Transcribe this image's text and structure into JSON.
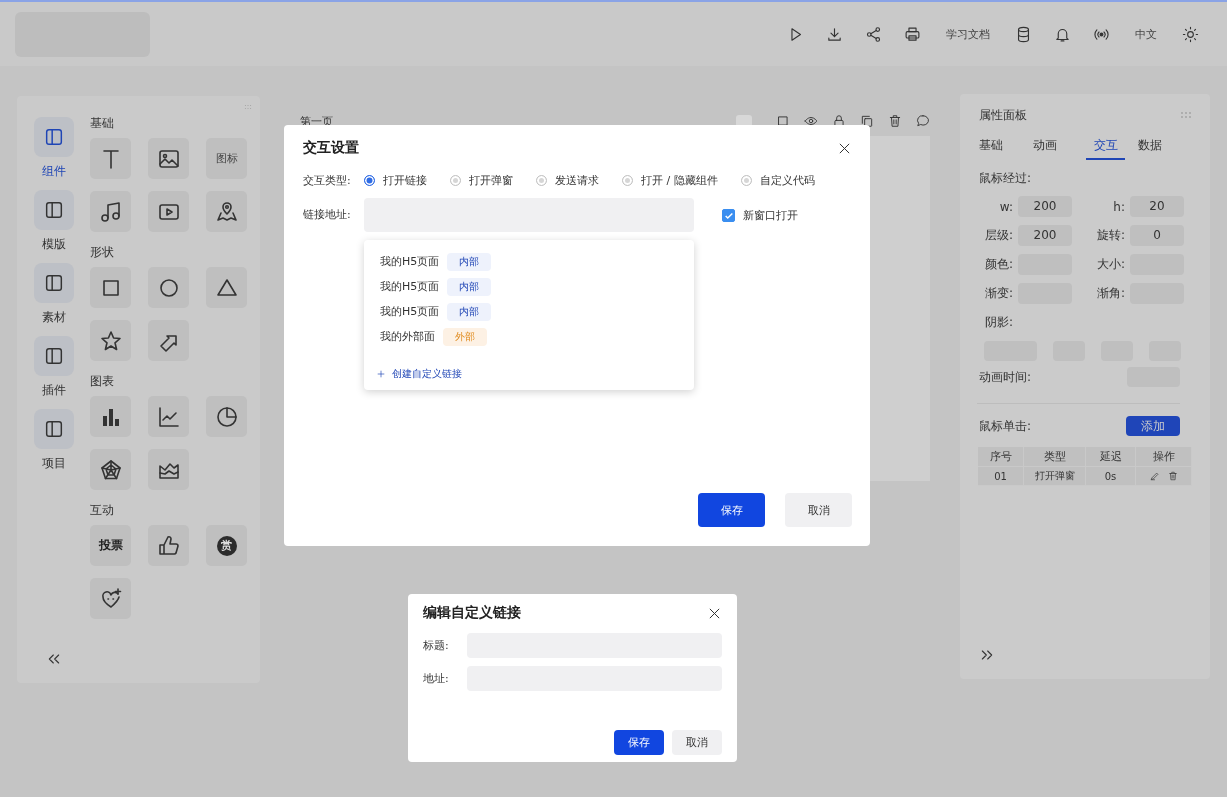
{
  "topbar": {
    "doc_link": "学习文档",
    "language": "中文"
  },
  "left_nav": [
    {
      "label": "组件",
      "selected": true
    },
    {
      "label": "模版",
      "selected": false
    },
    {
      "label": "素材",
      "selected": false
    },
    {
      "label": "插件",
      "selected": false
    },
    {
      "label": "项目",
      "selected": false
    }
  ],
  "component_groups": [
    {
      "title": "基础",
      "items": [
        {
          "kind": "icon"
        },
        {
          "kind": "icon"
        },
        {
          "kind": "label",
          "label": "图标"
        },
        {
          "kind": "icon"
        },
        {
          "kind": "icon"
        },
        {
          "kind": "icon"
        }
      ]
    },
    {
      "title": "形状",
      "items": [
        {
          "kind": "icon"
        },
        {
          "kind": "icon"
        },
        {
          "kind": "icon"
        },
        {
          "kind": "icon"
        },
        {
          "kind": "icon"
        }
      ]
    },
    {
      "title": "图表",
      "items": [
        {
          "kind": "icon"
        },
        {
          "kind": "icon"
        },
        {
          "kind": "icon"
        },
        {
          "kind": "icon"
        },
        {
          "kind": "icon"
        }
      ]
    },
    {
      "title": "互动",
      "items": [
        {
          "kind": "bold",
          "label": "投票"
        },
        {
          "kind": "icon"
        },
        {
          "kind": "coin",
          "label": "赏"
        },
        {
          "kind": "icon"
        }
      ]
    }
  ],
  "canvas": {
    "page_title": "第一页"
  },
  "property_panel": {
    "title": "属性面板",
    "tabs": [
      {
        "label": "基础",
        "selected": false
      },
      {
        "label": "动画",
        "selected": false
      },
      {
        "label": "交互",
        "selected": true
      },
      {
        "label": "数据",
        "selected": false
      }
    ],
    "hover_label": "鼠标经过:",
    "fields": [
      {
        "label": "w:",
        "value": "200"
      },
      {
        "label": "h:",
        "value": "20"
      },
      {
        "label": "层级:",
        "value": "200"
      },
      {
        "label": "旋转:",
        "value": "0"
      },
      {
        "label": "颜色:"
      },
      {
        "label": "大小:"
      },
      {
        "label": "渐变:"
      },
      {
        "label": "渐角:"
      }
    ],
    "shadow_label": "阴影:",
    "animation_time_label": "动画时间:",
    "click_label": "鼠标单击:",
    "add_button": "添加",
    "table": {
      "columns": [
        "序号",
        "类型",
        "延迟",
        "操作"
      ],
      "rows": [
        [
          "01",
          "打开弹窗",
          "0s"
        ]
      ]
    }
  },
  "interaction_dialog": {
    "title": "交互设置",
    "type_label": "交互类型:",
    "options": [
      {
        "label": "打开链接",
        "selected": true
      },
      {
        "label": "打开弹窗",
        "selected": false
      },
      {
        "label": "发送请求",
        "selected": false
      },
      {
        "label": "打开 / 隐藏组件",
        "selected": false
      },
      {
        "label": "自定义代码",
        "selected": false
      }
    ],
    "url_label": "链接地址:",
    "new_window": {
      "label": "新窗口打开",
      "checked": true
    },
    "links": [
      {
        "label": "我的H5页面",
        "tag": "内部",
        "kind": "internal"
      },
      {
        "label": "我的H5页面",
        "tag": "内部",
        "kind": "internal"
      },
      {
        "label": "我的H5页面",
        "tag": "内部",
        "kind": "internal"
      },
      {
        "label": "我的外部面",
        "tag": "外部",
        "kind": "external"
      }
    ],
    "create_link": "创建自定义链接",
    "save": "保存",
    "cancel": "取消"
  },
  "link_dialog": {
    "title": "编辑自定义链接",
    "fields": [
      {
        "label": "标题:"
      },
      {
        "label": "地址:"
      }
    ],
    "save": "保存",
    "cancel": "取消"
  }
}
